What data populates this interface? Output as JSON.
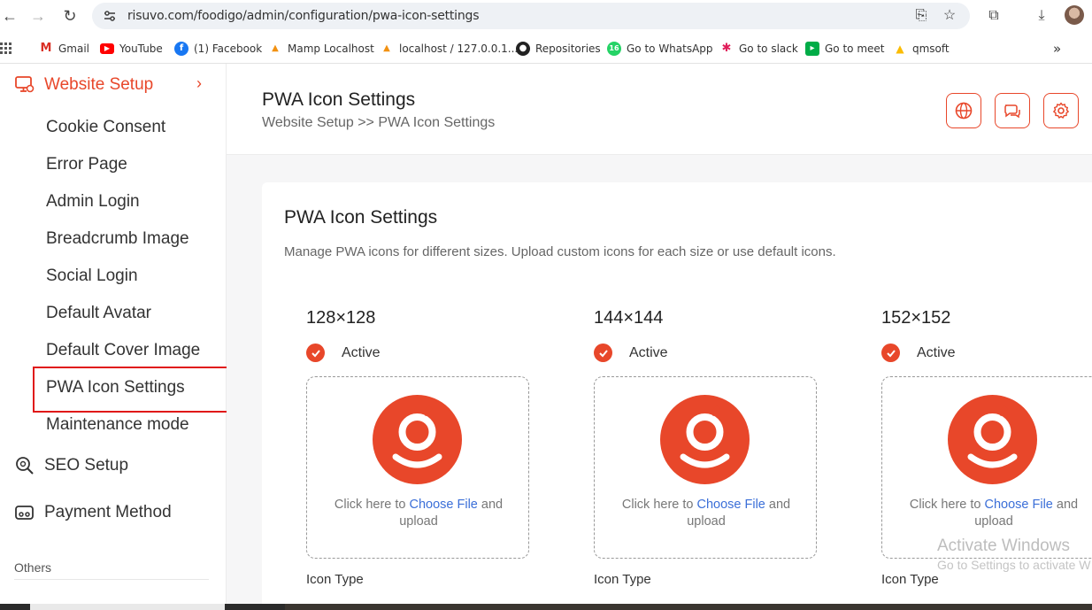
{
  "browser": {
    "url": "risuvo.com/foodigo/admin/configuration/pwa-icon-settings",
    "bookmarks": [
      {
        "label": "Gmail",
        "icon": "gmail-icon",
        "color": "#d93025"
      },
      {
        "label": "YouTube",
        "icon": "youtube-icon",
        "color": "#ff0000"
      },
      {
        "label": "(1) Facebook",
        "icon": "facebook-icon",
        "color": "#1877f2"
      },
      {
        "label": "Mamp Localhost",
        "icon": "phpmyadmin-icon",
        "color": "#f29111"
      },
      {
        "label": "localhost / 127.0.0.1...",
        "icon": "phpmyadmin-icon",
        "color": "#f29111"
      },
      {
        "label": "Repositories",
        "icon": "github-icon",
        "color": "#222222"
      },
      {
        "label": "Go to WhatsApp",
        "icon": "whatsapp-icon",
        "color": "#25d366"
      },
      {
        "label": "Go to slack",
        "icon": "slack-icon",
        "color": "#e01e5a"
      },
      {
        "label": "Go to meet",
        "icon": "meet-icon",
        "color": "#00ac47"
      },
      {
        "label": "qmsoft",
        "icon": "drive-icon",
        "color": "#fbbc04"
      }
    ],
    "whatsapp_badge": "16"
  },
  "sidebar": {
    "section": "Website Setup",
    "items": [
      "Cookie Consent",
      "Error Page",
      "Admin Login",
      "Breadcrumb Image",
      "Social Login",
      "Default Avatar",
      "Default Cover Image",
      "PWA Icon Settings",
      "Maintenance mode"
    ],
    "active_item": "PWA Icon Settings",
    "seo": "SEO Setup",
    "payment": "Payment Method",
    "others": "Others"
  },
  "header": {
    "title": "PWA Icon Settings",
    "breadcrumb": "Website Setup >> PWA Icon Settings"
  },
  "card": {
    "title": "PWA Icon Settings",
    "description": "Manage PWA icons for different sizes. Upload custom icons for each size or use default icons.",
    "icons": [
      {
        "size": "128×128",
        "status": "Active",
        "click_text": "Click here to",
        "choose": "Choose File",
        "and": "and",
        "upload": "upload",
        "type_label": "Icon Type"
      },
      {
        "size": "144×144",
        "status": "Active",
        "click_text": "Click here to",
        "choose": "Choose File",
        "and": "and",
        "upload": "upload",
        "type_label": "Icon Type"
      },
      {
        "size": "152×152",
        "status": "Active",
        "click_text": "Click here to",
        "choose": "Choose File",
        "and": "and",
        "upload": "upload",
        "type_label": "Icon Type"
      }
    ]
  },
  "watermark": {
    "line1": "Activate Windows",
    "line2": "Go to Settings to activate W"
  },
  "colors": {
    "accent": "#e8472a",
    "link": "#3b6fd8"
  }
}
